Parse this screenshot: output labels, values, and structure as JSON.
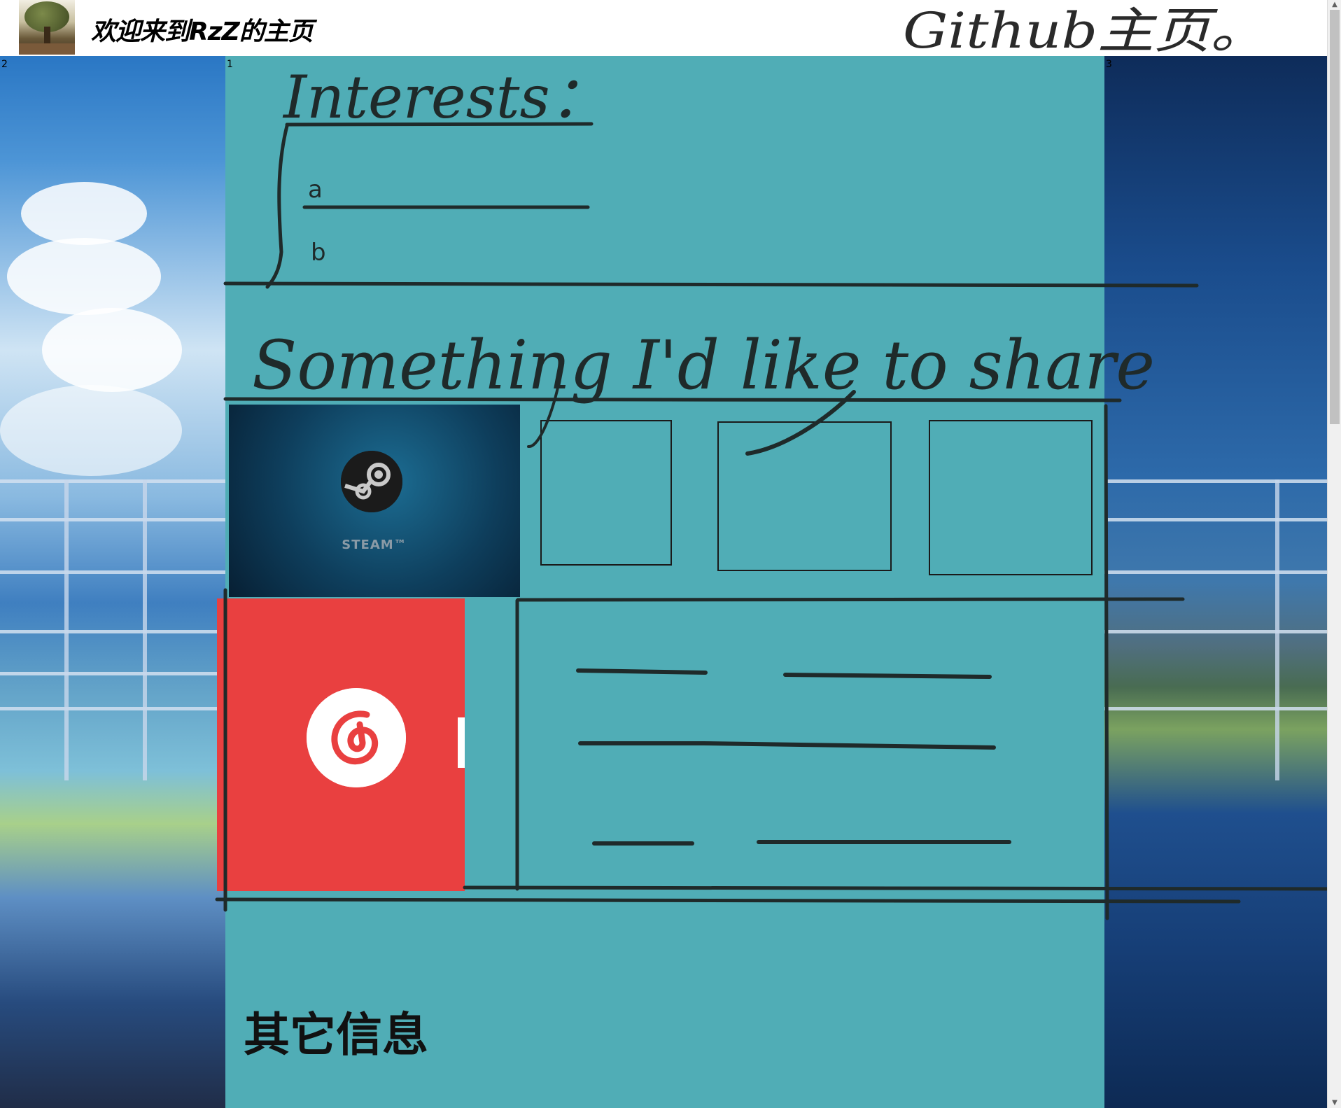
{
  "header": {
    "title": "欢迎来到RzZ的主页",
    "github_link": "Github主页。"
  },
  "frames": {
    "left_number": "2",
    "center_number": "1",
    "right_number": "3"
  },
  "sketch": {
    "interests_heading": "Interests：",
    "interest_markers": [
      "a",
      "b"
    ],
    "share_heading": "Something I'd like to share"
  },
  "cards": {
    "steam_label": "STEAM™"
  },
  "footer": {
    "other_info": "其它信息"
  },
  "colors": {
    "center_background": "#50adb6",
    "music_card": "#e94040",
    "steam_card": "#0e3e5c",
    "ink": "#1a1a1a"
  },
  "icons": [
    "avatar-image",
    "steam-logo-icon",
    "netease-music-icon",
    "scroll-up-icon",
    "scroll-down-icon"
  ]
}
